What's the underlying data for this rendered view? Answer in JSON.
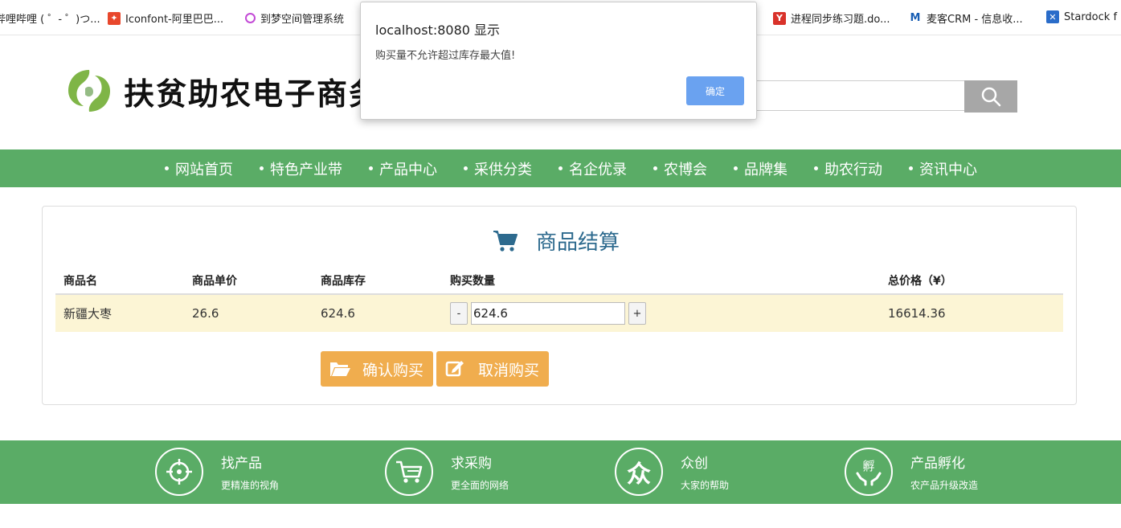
{
  "bookmarks": [
    {
      "label": "哔哩哔哩 ( ゜- ゜)つ...",
      "icon": "bilibili-icon"
    },
    {
      "label": "Iconfont-阿里巴巴...",
      "icon": "iconfont-icon"
    },
    {
      "label": "到梦空间管理系统",
      "icon": "dream-space-icon"
    },
    {
      "label": "进程同步练习题.do...",
      "icon": "document-icon"
    },
    {
      "label": "麦客CRM - 信息收...",
      "icon": "crm-icon"
    },
    {
      "label": "Stardock f",
      "icon": "stardock-icon"
    }
  ],
  "header": {
    "site_title": "扶贫助农电子商务",
    "search_placeholder": ""
  },
  "nav": {
    "items": [
      "网站首页",
      "特色产业带",
      "产品中心",
      "采供分类",
      "名企优录",
      "农博会",
      "品牌集",
      "助农行动",
      "资讯中心"
    ]
  },
  "checkout": {
    "title": "商品结算",
    "columns": {
      "name": "商品名",
      "price": "商品单价",
      "stock": "商品库存",
      "qty": "购买数量",
      "total": "总价格（¥）"
    },
    "row": {
      "name": "新疆大枣",
      "price": "26.6",
      "stock": "624.6",
      "qty": "624.6",
      "minus": "-",
      "plus": "+",
      "total": "16614.36"
    },
    "confirm_label": "确认购买",
    "cancel_label": "取消购买"
  },
  "footer": {
    "features": [
      {
        "title": "找产品",
        "subtitle": "更精准的视角"
      },
      {
        "title": "求采购",
        "subtitle": "更全面的网络"
      },
      {
        "title": "众创",
        "subtitle": "大家的帮助",
        "glyph": "众"
      },
      {
        "title": "产品孵化",
        "subtitle": "农产品升级改造",
        "glyph": "孵"
      }
    ]
  },
  "dialog": {
    "title": "localhost:8080 显示",
    "message": "购买量不允许超过库存最大值!",
    "ok_label": "确定"
  },
  "colors": {
    "green": "#5aac66",
    "orange": "#f0ad4e",
    "title_blue": "#2d6a8e",
    "row_highlight": "#fcf5d5",
    "ok_blue": "#6aa2f0"
  }
}
